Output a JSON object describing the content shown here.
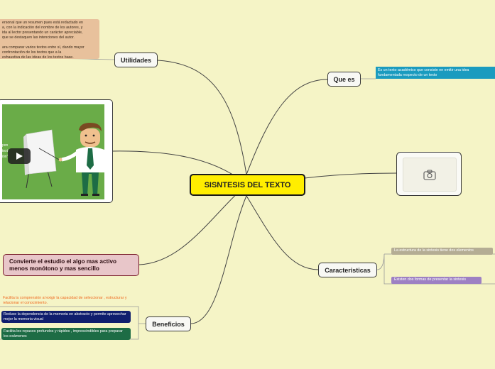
{
  "central": {
    "label": "SISNTESIS DEL TEXTO"
  },
  "branches": {
    "utilidades": {
      "label": "Utilidades",
      "note_lines": [
        "ersonal que un resumen pues está redactado en",
        "a, con la indicación del nombre de los autores, y",
        "ida al lector presentando un carácter apreciable,",
        "que se destaquen las intenciones del autor.",
        "",
        "ara comparar varios textos entre sí, dando mayor",
        " confrontación de los textos que a la",
        " exhaustiva de las ideas de los textos base."
      ]
    },
    "video": {
      "caption_lines": [
        "pon",
        "text",
        "ión\""
      ],
      "play_icon": "play-icon"
    },
    "convierte": {
      "label": "Convierte el estudio el algo mas activo menos monótono  y mas sencillo"
    },
    "beneficios": {
      "label": "Beneficios",
      "items": [
        "Facilita la comprensión  al exigir la capacidad de seleccionar , estructurar y relacionar el conocimiento.",
        "Reduce la dependencia de la memoria en abstracto y permite aprovechar mejor la memoria visual",
        "Facilita los repasos profundos y rápidos , imprescindibles  para preparar los exámenes"
      ]
    },
    "que_es": {
      "label": "Que es",
      "note": "Es un texto académico que consiste en emitir una idea fundamentada respecto de un texto"
    },
    "image": {
      "icon": "camera-icon"
    },
    "caracteristicas": {
      "label": "Caracteristicas",
      "items": [
        "La estructura de la sintesis tiene dos elementos",
        "Existen dos formas de presentar la sintesis"
      ]
    }
  },
  "colors": {
    "background": "#f5f4c6",
    "central_fill": "#ffee00",
    "que_es_note": "#1a9bbf",
    "utilidades_note": "#e8c19c",
    "convierte_fill": "#e8c6c9",
    "beneficio_orange": "#ef6a20",
    "beneficio_navy": "#101f6e",
    "beneficio_green": "#1d6c45",
    "caract_gray": "#b4ad94",
    "caract_purple": "#9d80c3"
  }
}
